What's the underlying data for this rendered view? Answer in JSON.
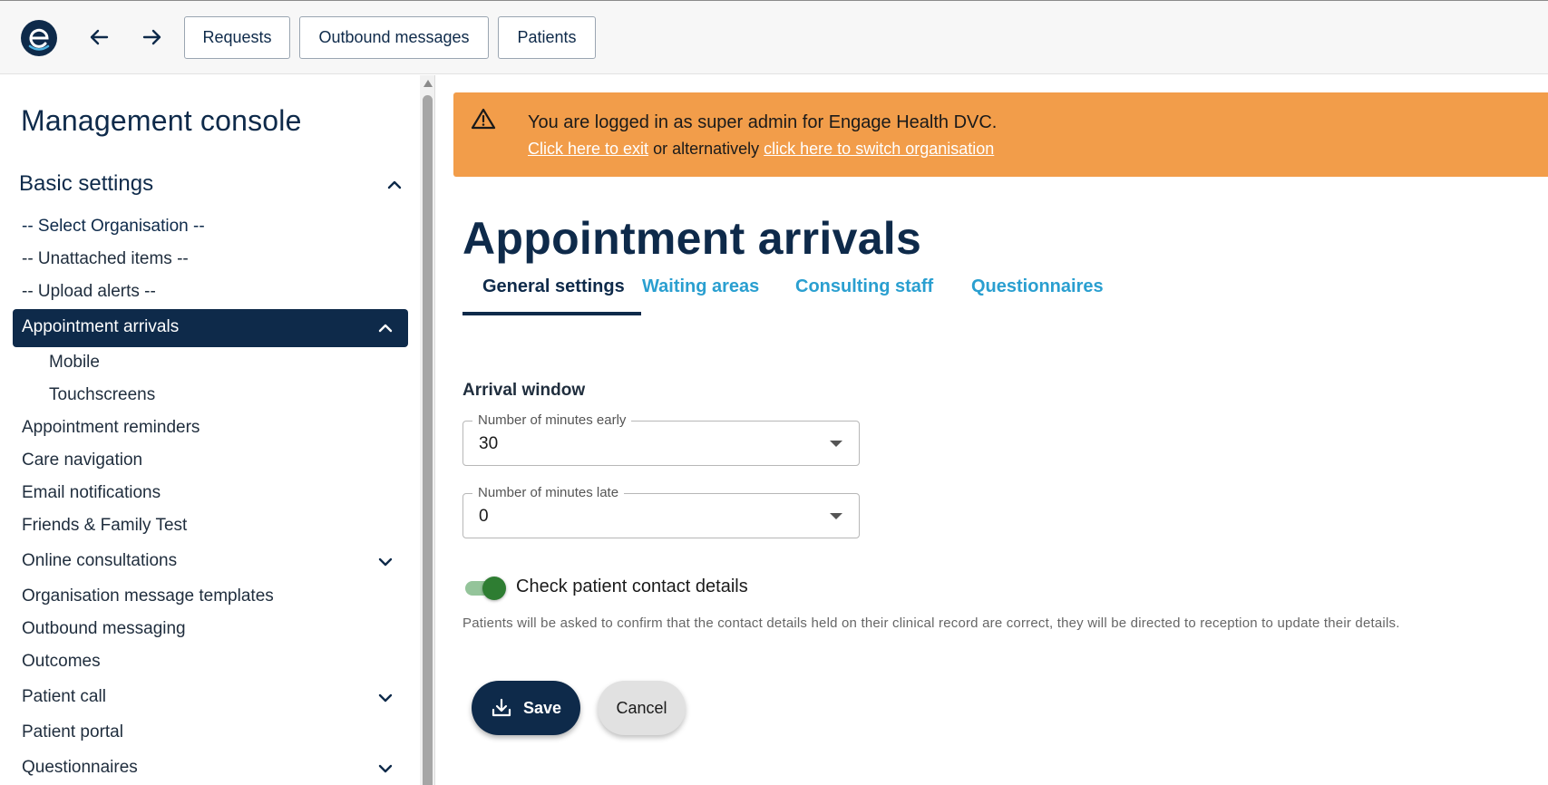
{
  "topbar": {
    "logo_icon": "engage-logo",
    "back_icon": "arrow-left-icon",
    "forward_icon": "arrow-right-icon",
    "buttons": [
      "Requests",
      "Outbound messages",
      "Patients"
    ]
  },
  "sidebar": {
    "title": "Management console",
    "section": "Basic settings",
    "items": [
      {
        "label": "-- Select Organisation --"
      },
      {
        "label": "-- Unattached items --"
      },
      {
        "label": "-- Upload alerts --"
      },
      {
        "label": "Appointment arrivals"
      },
      {
        "label": "Mobile"
      },
      {
        "label": "Touchscreens"
      },
      {
        "label": "Appointment reminders"
      },
      {
        "label": "Care navigation"
      },
      {
        "label": "Email notifications"
      },
      {
        "label": "Friends & Family Test"
      },
      {
        "label": "Online consultations"
      },
      {
        "label": "Organisation message templates"
      },
      {
        "label": "Outbound messaging"
      },
      {
        "label": "Outcomes"
      },
      {
        "label": "Patient call"
      },
      {
        "label": "Patient portal"
      },
      {
        "label": "Questionnaires"
      }
    ]
  },
  "banner": {
    "message": "You are logged in as super admin for Engage Health DVC.",
    "exit_link": "Click here to exit",
    "middle_text": "or alternatively",
    "switch_link": "click here to switch organisation",
    "color": "#f29d4a"
  },
  "main": {
    "title": "Appointment arrivals",
    "tabs": [
      {
        "label": "General settings"
      },
      {
        "label": "Waiting areas"
      },
      {
        "label": "Consulting staff"
      },
      {
        "label": "Questionnaires"
      }
    ],
    "active_tab": "General settings",
    "arrival_window": {
      "heading": "Arrival window",
      "early_label": "Number of minutes early",
      "early_value": "30",
      "late_label": "Number of minutes late",
      "late_value": "0"
    },
    "check_contact": {
      "label": "Check patient contact details",
      "enabled": true,
      "helper": "Patients will be asked to confirm that the contact details held on their clinical record are correct, they will be directed to reception to update their details."
    },
    "save_label": "Save",
    "cancel_label": "Cancel"
  },
  "colors": {
    "primary": "#0e2a4a",
    "tab_link": "#2a9fd0",
    "toggle_on": "#2e7d32"
  }
}
